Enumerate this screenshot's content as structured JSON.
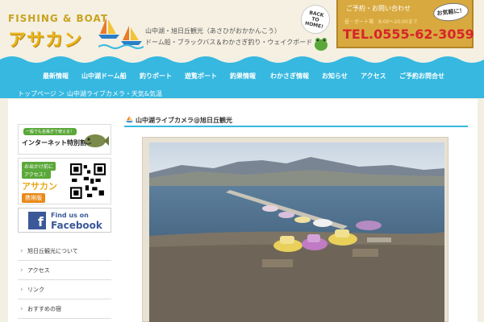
{
  "header": {
    "logo_top": "FISHING & BOAT",
    "logo_main": "アサカン",
    "tagline_line1": "山中湖・旭日丘観光（あさひがおかかんこう）",
    "tagline_line2": "ドーム船・ブラックバス＆わかさぎ釣り・ウェイクボード",
    "back_home": [
      "BACK",
      "TO",
      "HOME!"
    ],
    "contact": {
      "line1": "ご予約・お問い合わせ",
      "line2": "昼・ボート場　8:00〜20:00まで",
      "tel": "TEL.0555-62-3059",
      "badge": "お気軽に！"
    }
  },
  "nav": {
    "items": [
      "最新情報",
      "山中湖ドーム船",
      "釣りポート",
      "遊覧ボート",
      "釣果情報",
      "わかさぎ情報",
      "お知らせ",
      "アクセス",
      "ご予約お問合せ"
    ]
  },
  "breadcrumb": "トップページ ＞ 山中湖ライブカメラ・天気&気温",
  "sidebar": {
    "banner1_top": "一般でも名株ぎで使える！",
    "banner1_main": "インターネット特別割引券",
    "banner2_line1": "お出かけ前に",
    "banner2_line2": "アクセス！",
    "banner2_line3": "アサカン",
    "banner2_line4": "携帯版",
    "facebook_line1": "Find us on",
    "facebook_line2": "Facebook",
    "menu": [
      "旭日丘観光について",
      "アクセス",
      "リンク",
      "おすすめの宿"
    ]
  },
  "main": {
    "title": "山中湖ライブカメラ@旭日丘観光"
  },
  "colors": {
    "nav_blue": "#36b8e0",
    "accent_orange": "#d8a93f",
    "tel_red": "#d8242a",
    "logo_yellow": "#e8b51a"
  }
}
